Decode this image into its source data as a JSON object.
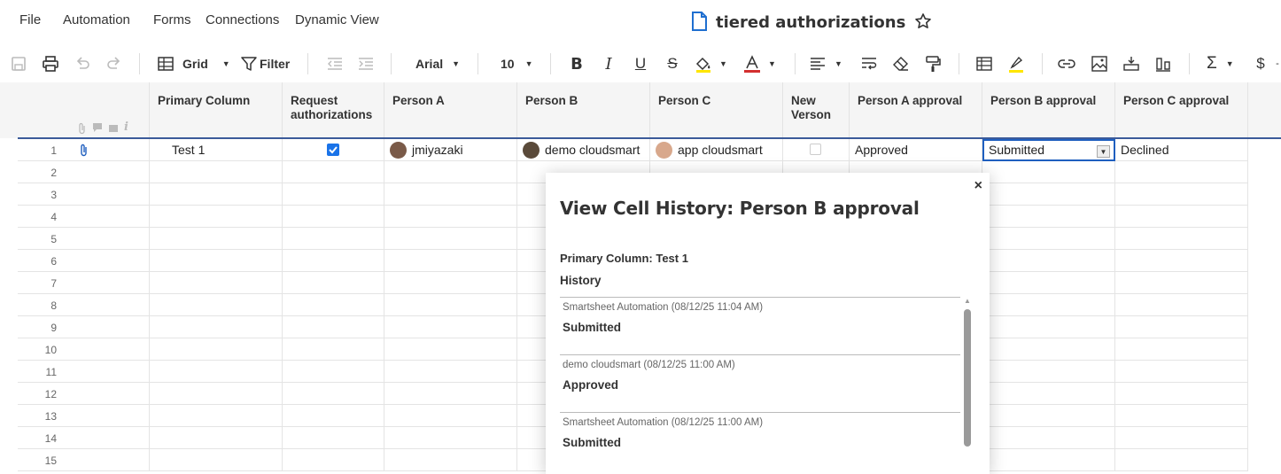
{
  "menu": [
    "File",
    "Automation",
    "Forms",
    "Connections",
    "Dynamic View"
  ],
  "doc": {
    "title": "tiered authorizations"
  },
  "toolbar": {
    "view_label": "Grid",
    "filter_label": "Filter",
    "font_family": "Arial",
    "font_size": "10"
  },
  "columns": [
    "Primary Column",
    "Request authorizations",
    "Person A",
    "Person B",
    "Person C",
    "New Verson",
    "Person A approval",
    "Person B approval",
    "Person C approval"
  ],
  "rows": {
    "row1": {
      "num": "1",
      "primary": "Test 1",
      "request_checked": true,
      "person_a": "jmiyazaki",
      "person_b": "demo cloudsmart",
      "person_c": "app cloudsmart",
      "new_version_checked": false,
      "a_approval": "Approved",
      "b_approval": "Submitted",
      "c_approval": "Declined"
    },
    "numbers": [
      "2",
      "3",
      "4",
      "5",
      "6",
      "7",
      "8",
      "9",
      "10",
      "11",
      "12",
      "13",
      "14",
      "15"
    ]
  },
  "modal": {
    "title": "View Cell History: Person B approval",
    "primary_line": "Primary Column: Test 1",
    "history_label": "History",
    "entries": [
      {
        "meta": "Smartsheet Automation (08/12/25 11:04 AM)",
        "value": "Submitted"
      },
      {
        "meta": "demo cloudsmart (08/12/25 11:00 AM)",
        "value": "Approved"
      },
      {
        "meta": "Smartsheet Automation (08/12/25 11:00 AM)",
        "value": "Submitted"
      }
    ]
  },
  "colors": {
    "accent": "#1f5fbf",
    "checkbox": "#1a73e8",
    "frozen_line": "#3b5a9a"
  }
}
